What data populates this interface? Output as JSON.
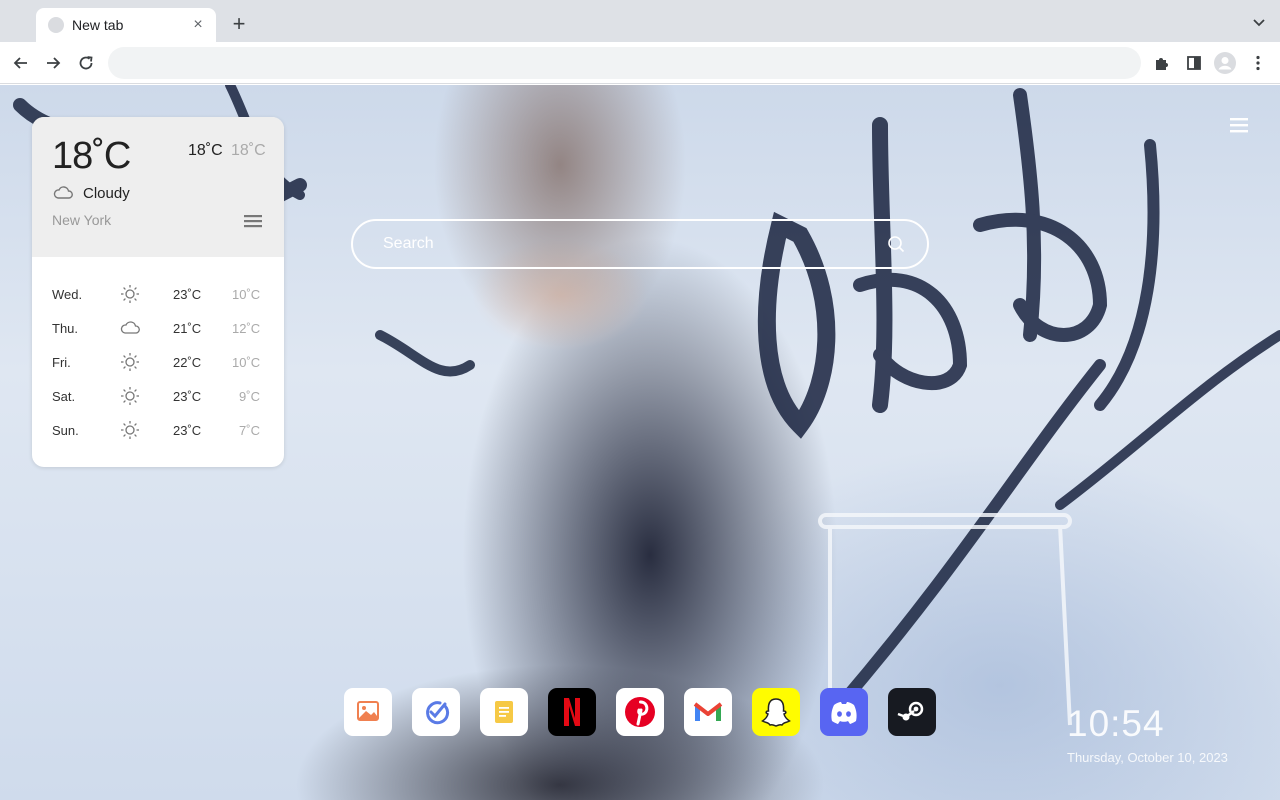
{
  "browser": {
    "tab_title": "New tab",
    "tab_close": "×",
    "new_tab": "+",
    "address_value": ""
  },
  "weather": {
    "current_temp": "18˚C",
    "high": "18˚C",
    "low": "18˚C",
    "condition": "Cloudy",
    "condition_icon": "cloud-icon",
    "city": "New York",
    "forecast": [
      {
        "day": "Wed.",
        "icon": "sun-icon",
        "high": "23˚C",
        "low": "10˚C"
      },
      {
        "day": "Thu.",
        "icon": "cloud-icon",
        "high": "21˚C",
        "low": "12˚C"
      },
      {
        "day": "Fri.",
        "icon": "sun-icon",
        "high": "22˚C",
        "low": "10˚C"
      },
      {
        "day": "Sat.",
        "icon": "sun-icon",
        "high": "23˚C",
        "low": "9˚C"
      },
      {
        "day": "Sun.",
        "icon": "sun-icon",
        "high": "23˚C",
        "low": "7˚C"
      }
    ]
  },
  "search": {
    "placeholder": "Search"
  },
  "dock": {
    "apps": [
      {
        "name": "gallery",
        "icon": "gallery-icon"
      },
      {
        "name": "todo",
        "icon": "todo-icon"
      },
      {
        "name": "notes",
        "icon": "notes-icon"
      },
      {
        "name": "netflix",
        "icon": "netflix-icon"
      },
      {
        "name": "pinterest",
        "icon": "pinterest-icon"
      },
      {
        "name": "gmail",
        "icon": "gmail-icon"
      },
      {
        "name": "snapchat",
        "icon": "snapchat-icon"
      },
      {
        "name": "discord",
        "icon": "discord-icon"
      },
      {
        "name": "steam",
        "icon": "steam-icon"
      }
    ]
  },
  "clock": {
    "time": "10:54",
    "date": "Thursday, October 10, 2023"
  },
  "colors": {
    "netflix": "#000000",
    "netflix_red": "#e50914",
    "pinterest": "#e60023",
    "snapchat": "#fffc00",
    "discord": "#5865f2",
    "steam": "#171a21"
  }
}
